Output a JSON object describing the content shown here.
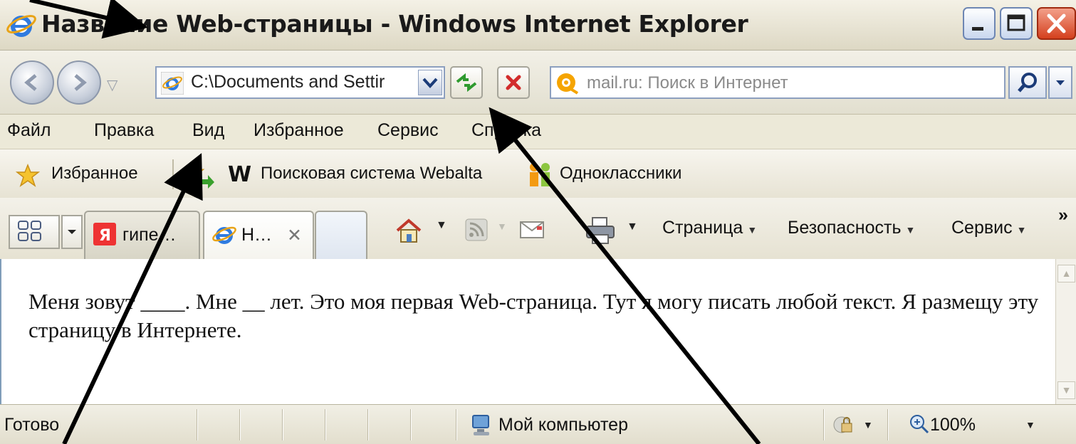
{
  "window": {
    "title": "Название Web-страницы - Windows Internet Explorer",
    "controls": {
      "minimize": "minimize-button",
      "maximize": "maximize-button",
      "close": "close-button"
    }
  },
  "address_bar": {
    "url": "C:\\Documents and Settir",
    "search_placeholder": "mail.ru: Поиск в Интернет"
  },
  "menu": [
    "Файл",
    "Правка",
    "Вид",
    "Избранное",
    "Сервис",
    "Справка"
  ],
  "favorites_bar": {
    "favorites_label": "Избранное",
    "links": [
      "Поисковая система Webalta",
      "Одноклассники"
    ]
  },
  "tabs": {
    "items": [
      "гипе…",
      "Н…"
    ],
    "close_glyph": "✕"
  },
  "command_bar": {
    "page": "Страница",
    "safety": "Безопасность",
    "tools": "Сервис",
    "more": "»"
  },
  "content": {
    "text": "Меня зовут ____. Мне __ лет. Это моя первая Web-страница. Тут я могу писать любой текст. Я размещу эту страницу в Интернете."
  },
  "status_bar": {
    "status": "Готово",
    "zone": "Мой компьютер",
    "zoom": "100%"
  },
  "colors": {
    "accent": "#316ac5",
    "close_red": "#d4401e",
    "chrome": "#ece9d8"
  }
}
